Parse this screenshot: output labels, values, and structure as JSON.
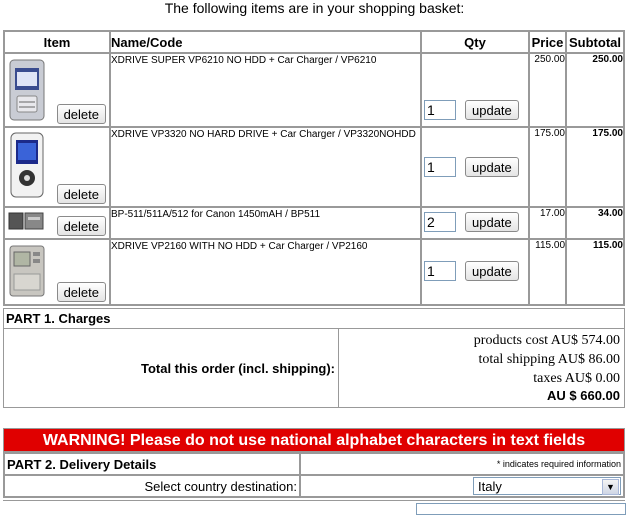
{
  "intro": "The following items are in your shopping basket:",
  "columns": {
    "item": "Item",
    "name": "Name/Code",
    "qty": "Qty",
    "price": "Price",
    "subtotal": "Subtotal"
  },
  "buttons": {
    "delete": "delete",
    "update": "update"
  },
  "items": [
    {
      "name": "XDRIVE SUPER VP6210 NO HDD + Car Charger / VP6210",
      "qty": "1",
      "price": "250.00",
      "subtotal": "250.00"
    },
    {
      "name": "XDRIVE VP3320 NO HARD DRIVE + Car Charger / VP3320NOHDD",
      "qty": "1",
      "price": "175.00",
      "subtotal": "175.00"
    },
    {
      "name": "BP-511/511A/512 for Canon 1450mAH / BP511",
      "qty": "2",
      "price": "17.00",
      "subtotal": "34.00"
    },
    {
      "name": "XDRIVE VP2160 WITH NO HDD + Car Charger / VP2160",
      "qty": "1",
      "price": "115.00",
      "subtotal": "115.00"
    }
  ],
  "charges": {
    "header": "PART 1. Charges",
    "total_label": "Total this order (incl. shipping):",
    "products_cost": "products cost AU$ 574.00",
    "total_shipping": "total shipping AU$ 86.00",
    "taxes": "taxes AU$ 0.00",
    "grand_total": "AU $ 660.00"
  },
  "warning": "WARNING! Please do not use national alphabet characters in text fields",
  "delivery": {
    "header": "PART 2. Delivery Details",
    "required_note": "* indicates required information",
    "country_label": "Select country destination:",
    "country_value": "Italy"
  },
  "colors": {
    "warning_bg": "#e00000",
    "border": "#999999"
  }
}
